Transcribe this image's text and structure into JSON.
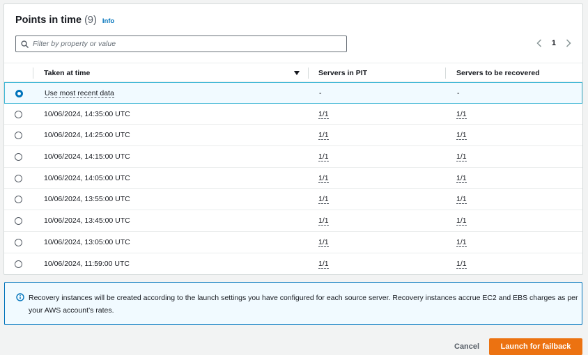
{
  "header": {
    "title": "Points in time",
    "count": "(9)",
    "info_label": "Info"
  },
  "filter": {
    "placeholder": "Filter by property or value",
    "value": ""
  },
  "pagination": {
    "current_page": "1"
  },
  "table": {
    "columns": [
      "Taken at time",
      "Servers in PIT",
      "Servers to be recovered"
    ],
    "rows": [
      {
        "taken_at": "Use most recent data",
        "servers_in_pit": "-",
        "servers_to_recover": "-",
        "selected": true
      },
      {
        "taken_at": "10/06/2024, 14:35:00 UTC",
        "servers_in_pit": "1/1",
        "servers_to_recover": "1/1",
        "selected": false
      },
      {
        "taken_at": "10/06/2024, 14:25:00 UTC",
        "servers_in_pit": "1/1",
        "servers_to_recover": "1/1",
        "selected": false
      },
      {
        "taken_at": "10/06/2024, 14:15:00 UTC",
        "servers_in_pit": "1/1",
        "servers_to_recover": "1/1",
        "selected": false
      },
      {
        "taken_at": "10/06/2024, 14:05:00 UTC",
        "servers_in_pit": "1/1",
        "servers_to_recover": "1/1",
        "selected": false
      },
      {
        "taken_at": "10/06/2024, 13:55:00 UTC",
        "servers_in_pit": "1/1",
        "servers_to_recover": "1/1",
        "selected": false
      },
      {
        "taken_at": "10/06/2024, 13:45:00 UTC",
        "servers_in_pit": "1/1",
        "servers_to_recover": "1/1",
        "selected": false
      },
      {
        "taken_at": "10/06/2024, 13:05:00 UTC",
        "servers_in_pit": "1/1",
        "servers_to_recover": "1/1",
        "selected": false
      },
      {
        "taken_at": "10/06/2024, 11:59:00 UTC",
        "servers_in_pit": "1/1",
        "servers_to_recover": "1/1",
        "selected": false
      }
    ]
  },
  "alert": {
    "icon": "info-circle-icon",
    "text": "Recovery instances will be created according to the launch settings you have configured for each source server. Recovery instances accrue EC2 and EBS charges as per your AWS account’s rates."
  },
  "actions": {
    "cancel_label": "Cancel",
    "launch_label": "Launch for failback"
  },
  "colors": {
    "accent": "#0073bb",
    "primary_button": "#ec7211",
    "selected_row_bg": "#f1faff",
    "selected_row_border": "#44b9d6"
  }
}
